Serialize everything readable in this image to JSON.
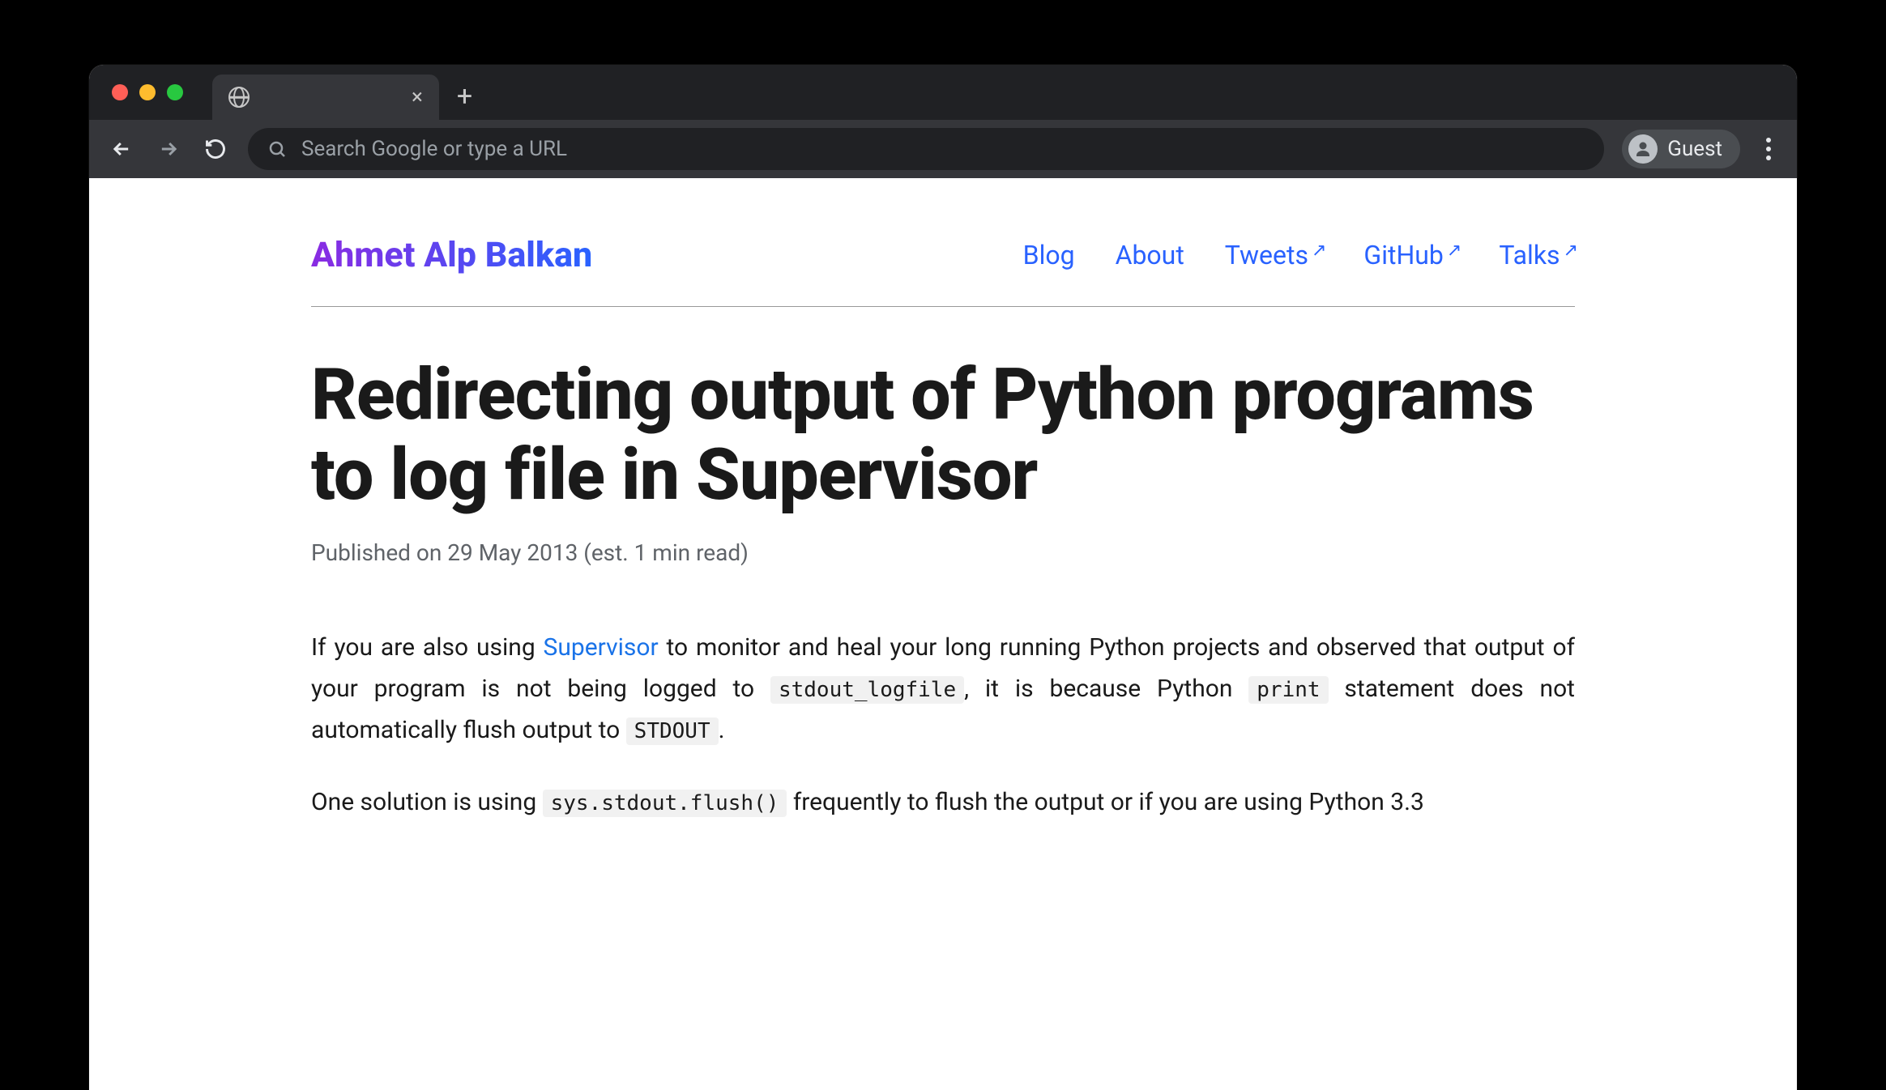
{
  "browser": {
    "omnibox_placeholder": "Search Google or type a URL",
    "guest_label": "Guest"
  },
  "site": {
    "title": "Ahmet Alp Balkan",
    "nav": {
      "blog": "Blog",
      "about": "About",
      "tweets": "Tweets",
      "github": "GitHub",
      "talks": "Talks"
    }
  },
  "article": {
    "title": "Redirecting output of Python programs to log file in Supervisor",
    "meta": "Published on 29 May 2013 (est. 1 min read)",
    "p1_a": "If you are also using ",
    "p1_link": "Supervisor",
    "p1_b": " to monitor and heal your long running Python projects and observed that output of your program is not being logged to ",
    "p1_code1": "stdout_logfile",
    "p1_c": ", it is because Python ",
    "p1_code2": "print",
    "p1_d": " statement does not automatically flush output to ",
    "p1_code3": "STDOUT",
    "p1_e": ".",
    "p2_a": "One solution is using ",
    "p2_code1": "sys.stdout.flush()",
    "p2_b": " frequently to flush the output or if you are using Python 3.3"
  }
}
